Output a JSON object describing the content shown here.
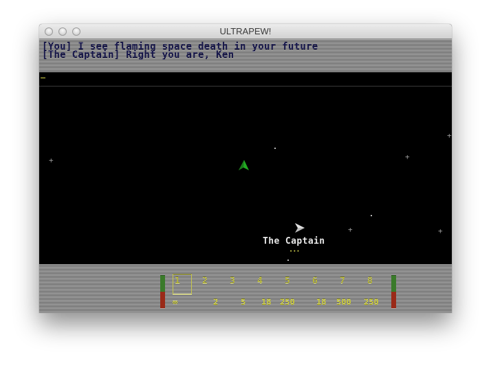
{
  "window": {
    "title": "ULTRAPEW!"
  },
  "chat": {
    "lines": [
      "[You] I see flaming space death in your future",
      "[The Captain] Right you are, Ken"
    ]
  },
  "field": {
    "other_ship_label": "The Captain",
    "other_ship_health": "•••"
  },
  "hud": {
    "weapon_slots": [
      "1",
      "2",
      "3",
      "4",
      "5",
      "6",
      "7",
      "8"
    ],
    "selected_slot": "1",
    "ammo_values": [
      "∞",
      "2",
      "5",
      "18",
      "250",
      "18",
      "500",
      "250"
    ]
  },
  "colors": {
    "player_ship": "#22aa22",
    "other_ship": "#bbbbbb",
    "chat_text": "#16164a",
    "hud_accent": "#c8c83a",
    "shield_bar": "#3a7a2a",
    "hull_bar": "#9a2a18"
  }
}
